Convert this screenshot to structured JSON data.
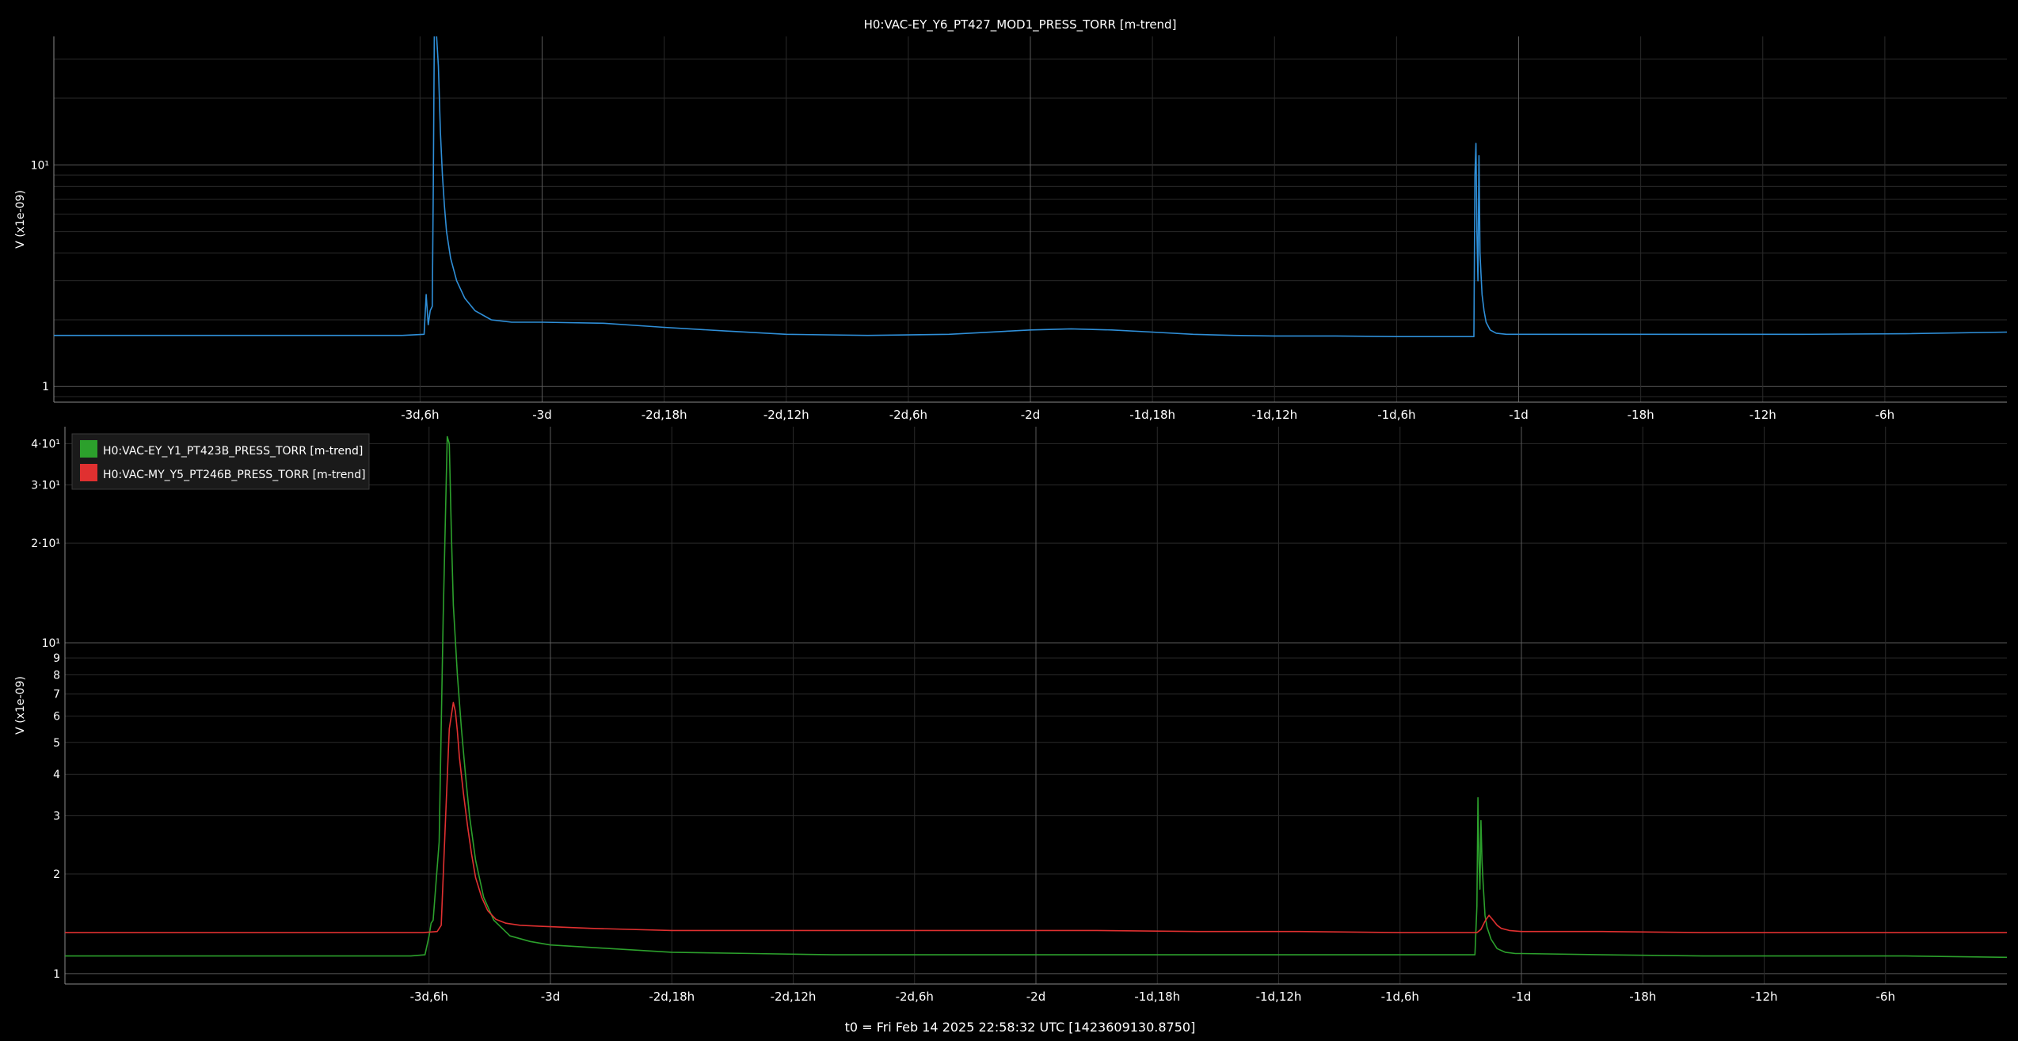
{
  "footer": "t0 = Fri Feb 14 2025 22:58:32 UTC [1423609130.8750]",
  "colors": {
    "background": "#000000",
    "grid_major": "#5a5a5a",
    "grid_minor": "#2a2a2a",
    "blue": "#2f8fd8",
    "green": "#2ca02c",
    "red": "#e03030"
  },
  "chart_data": [
    {
      "type": "line",
      "title": "H0:VAC-EY_Y6_PT427_MOD1_PRESS_TORR [m-trend]",
      "ylabel": "V (x1e-09)",
      "yscale": "log",
      "grid": true,
      "x_unit": "hours relative to t0",
      "xlim": [
        -96,
        0
      ],
      "ylim": [
        0.85,
        38
      ],
      "x_ticks": [
        {
          "x": -78,
          "label": "-3d,6h"
        },
        {
          "x": -72,
          "label": "-3d"
        },
        {
          "x": -66,
          "label": "-2d,18h"
        },
        {
          "x": -60,
          "label": "-2d,12h"
        },
        {
          "x": -54,
          "label": "-2d,6h"
        },
        {
          "x": -48,
          "label": "-2d"
        },
        {
          "x": -42,
          "label": "-1d,18h"
        },
        {
          "x": -36,
          "label": "-1d,12h"
        },
        {
          "x": -30,
          "label": "-1d,6h"
        },
        {
          "x": -24,
          "label": "-1d"
        },
        {
          "x": -18,
          "label": "-18h"
        },
        {
          "x": -12,
          "label": "-12h"
        },
        {
          "x": -6,
          "label": "-6h"
        }
      ],
      "y_ticks": [
        {
          "y": 1,
          "label": "1"
        },
        {
          "y": 10,
          "label": "10¹"
        }
      ],
      "series": [
        {
          "color": "#2f8fd8",
          "x": [
            -96,
            -90,
            -84,
            -78.9,
            -77.8,
            -77.7,
            -77.6,
            -77.5,
            -77.4,
            -77.35,
            -77.3,
            -77.2,
            -77.1,
            -77.0,
            -76.9,
            -76.8,
            -76.7,
            -76.5,
            -76.2,
            -75.8,
            -75.3,
            -74.5,
            -73.5,
            -72,
            -69,
            -66,
            -63,
            -60,
            -56,
            -52,
            -48,
            -46,
            -44,
            -42,
            -40,
            -38,
            -36,
            -33,
            -30,
            -27.4,
            -26.2,
            -26.15,
            -26.1,
            -26.05,
            -26.0,
            -25.95,
            -25.9,
            -25.85,
            -25.8,
            -25.7,
            -25.6,
            -25.4,
            -25.1,
            -24.6,
            -24,
            -20,
            -15,
            -10,
            -5,
            0
          ],
          "y": [
            1.7,
            1.7,
            1.7,
            1.7,
            1.72,
            2.6,
            1.9,
            2.2,
            2.3,
            8,
            40,
            40,
            28,
            14,
            9,
            6.5,
            5,
            3.8,
            3,
            2.5,
            2.2,
            2.0,
            1.95,
            1.95,
            1.93,
            1.85,
            1.78,
            1.72,
            1.7,
            1.72,
            1.8,
            1.82,
            1.8,
            1.76,
            1.72,
            1.7,
            1.69,
            1.69,
            1.68,
            1.68,
            1.68,
            9,
            12.5,
            5,
            3,
            11,
            4,
            3.2,
            2.6,
            2.2,
            1.95,
            1.8,
            1.74,
            1.72,
            1.72,
            1.72,
            1.72,
            1.72,
            1.73,
            1.76
          ]
        }
      ]
    },
    {
      "type": "line",
      "title": "",
      "ylabel": "V (x1e-09)",
      "yscale": "log",
      "grid": true,
      "legend_position": "top-left",
      "x_unit": "hours relative to t0",
      "xlim": [
        -96,
        0
      ],
      "ylim": [
        0.93,
        45
      ],
      "x_ticks": [
        {
          "x": -78,
          "label": "-3d,6h"
        },
        {
          "x": -72,
          "label": "-3d"
        },
        {
          "x": -66,
          "label": "-2d,18h"
        },
        {
          "x": -60,
          "label": "-2d,12h"
        },
        {
          "x": -54,
          "label": "-2d,6h"
        },
        {
          "x": -48,
          "label": "-2d"
        },
        {
          "x": -42,
          "label": "-1d,18h"
        },
        {
          "x": -36,
          "label": "-1d,12h"
        },
        {
          "x": -30,
          "label": "-1d,6h"
        },
        {
          "x": -24,
          "label": "-1d"
        },
        {
          "x": -18,
          "label": "-18h"
        },
        {
          "x": -12,
          "label": "-12h"
        },
        {
          "x": -6,
          "label": "-6h"
        }
      ],
      "y_ticks": [
        {
          "y": 1,
          "label": "1"
        },
        {
          "y": 2,
          "label": "2"
        },
        {
          "y": 3,
          "label": "3"
        },
        {
          "y": 4,
          "label": "4"
        },
        {
          "y": 5,
          "label": "5"
        },
        {
          "y": 6,
          "label": "6"
        },
        {
          "y": 7,
          "label": "7"
        },
        {
          "y": 8,
          "label": "8"
        },
        {
          "y": 9,
          "label": "9"
        },
        {
          "y": 10,
          "label": "10¹"
        },
        {
          "y": 20,
          "label": "2·10¹"
        },
        {
          "y": 30,
          "label": "3·10¹"
        },
        {
          "y": 40,
          "label": "4·10¹"
        }
      ],
      "series": [
        {
          "name": "H0:VAC-EY_Y1_PT423B_PRESS_TORR [m-trend]",
          "color": "#2ca02c",
          "x": [
            -96,
            -90,
            -84,
            -78.9,
            -78.2,
            -78.0,
            -77.9,
            -77.8,
            -77.5,
            -77.3,
            -77.1,
            -77.0,
            -76.9,
            -76.8,
            -76.6,
            -76.4,
            -76.2,
            -76.0,
            -75.7,
            -75.3,
            -74.8,
            -74,
            -73,
            -72,
            -69,
            -66,
            -62,
            -58,
            -54,
            -50,
            -46,
            -42,
            -38,
            -34,
            -30,
            -27.5,
            -26.3,
            -26.2,
            -26.15,
            -26.1,
            -26.05,
            -26.0,
            -25.95,
            -25.9,
            -25.85,
            -25.8,
            -25.7,
            -25.5,
            -25.2,
            -24.8,
            -24.3,
            -24,
            -20,
            -15,
            -10,
            -5,
            0
          ],
          "y": [
            1.13,
            1.13,
            1.13,
            1.13,
            1.14,
            1.3,
            1.42,
            1.45,
            2.5,
            12,
            42,
            40,
            22,
            13,
            8,
            5.5,
            4,
            3,
            2.2,
            1.7,
            1.45,
            1.3,
            1.25,
            1.22,
            1.19,
            1.16,
            1.15,
            1.14,
            1.14,
            1.14,
            1.14,
            1.14,
            1.14,
            1.14,
            1.14,
            1.14,
            1.14,
            1.6,
            3.4,
            2.2,
            1.8,
            2.9,
            2.2,
            1.9,
            1.7,
            1.5,
            1.38,
            1.27,
            1.19,
            1.16,
            1.15,
            1.15,
            1.14,
            1.13,
            1.13,
            1.13,
            1.12
          ]
        },
        {
          "name": "H0:VAC-MY_Y5_PT246B_PRESS_TORR [m-trend]",
          "color": "#e03030",
          "x": [
            -96,
            -90,
            -84,
            -78.3,
            -77.6,
            -77.4,
            -77.2,
            -77.0,
            -76.8,
            -76.7,
            -76.6,
            -76.5,
            -76.3,
            -76.1,
            -75.9,
            -75.7,
            -75.4,
            -75.1,
            -74.7,
            -74.2,
            -73.5,
            -72.5,
            -70,
            -66,
            -60,
            -55,
            -50,
            -45,
            -40,
            -35,
            -30,
            -26.2,
            -26.0,
            -25.8,
            -25.6,
            -25.4,
            -25.2,
            -25.0,
            -24.6,
            -24,
            -20,
            -15,
            -10,
            -5,
            0
          ],
          "y": [
            1.33,
            1.33,
            1.33,
            1.33,
            1.34,
            1.4,
            2.8,
            5.5,
            6.6,
            6.2,
            5.4,
            4.5,
            3.5,
            2.8,
            2.3,
            1.95,
            1.7,
            1.55,
            1.46,
            1.42,
            1.4,
            1.39,
            1.37,
            1.35,
            1.35,
            1.35,
            1.35,
            1.35,
            1.34,
            1.34,
            1.33,
            1.33,
            1.36,
            1.44,
            1.5,
            1.45,
            1.4,
            1.37,
            1.35,
            1.34,
            1.34,
            1.33,
            1.33,
            1.33,
            1.33
          ]
        }
      ]
    }
  ]
}
